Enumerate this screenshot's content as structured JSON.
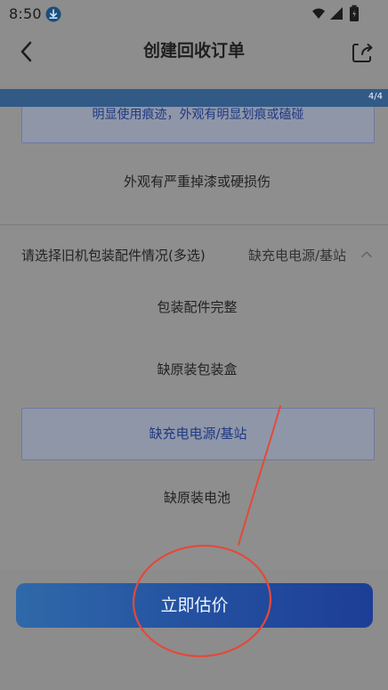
{
  "status_bar": {
    "time": "8:50",
    "icons": {
      "download": "download-icon",
      "wifi": "wifi-icon",
      "signal": "signal-icon",
      "battery": "battery-icon"
    }
  },
  "header": {
    "title": "创建回收订单",
    "back_icon": "chevron-left-icon",
    "share_icon": "share-icon"
  },
  "progress": {
    "label": "4/4",
    "fraction": 1.0
  },
  "appearance_options": [
    {
      "label": "明显使用痕迹，外观有明显划痕或磕碰",
      "selected": true
    },
    {
      "label": "外观有严重掉漆或硬损伤",
      "selected": false
    }
  ],
  "accessories_section": {
    "label": "请选择旧机包装配件情况(多选)",
    "value": "缺充电电源/基站",
    "icon": "chevron-up-icon",
    "options": [
      {
        "label": "包装配件完整",
        "selected": false
      },
      {
        "label": "缺原装包装盒",
        "selected": false
      },
      {
        "label": "缺充电电源/基站",
        "selected": true
      },
      {
        "label": "缺原装电池",
        "selected": false
      }
    ]
  },
  "cta": {
    "label": "立即估价"
  },
  "annotation": {
    "color": "#e24a3a"
  }
}
